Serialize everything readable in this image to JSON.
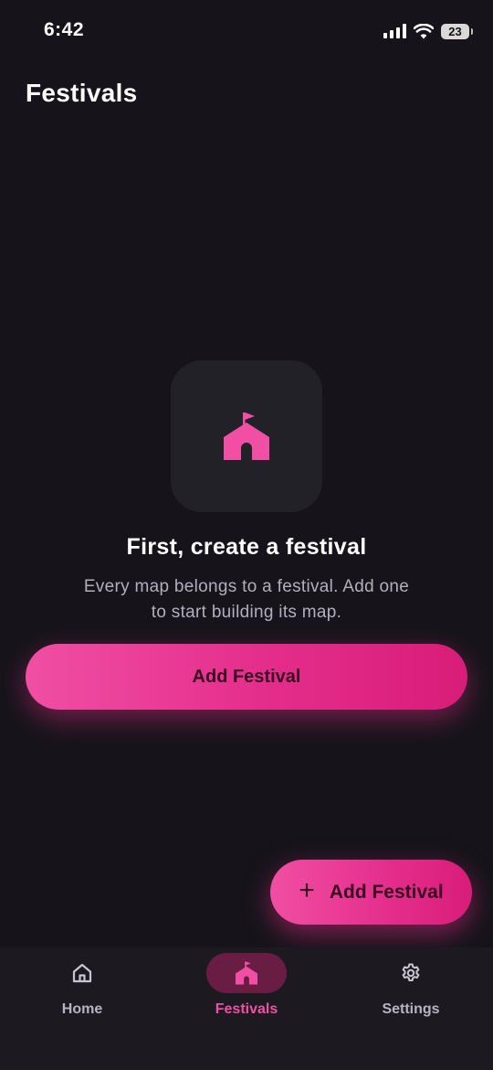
{
  "status_bar": {
    "time": "6:42",
    "battery_level": "23",
    "icons": [
      "cellular-signal-icon",
      "wifi-icon",
      "battery-icon"
    ]
  },
  "header": {
    "title": "Festivals"
  },
  "empty_state": {
    "icon": "festival-tent-icon",
    "title": "First, create a festival",
    "description": "Every map belongs to a festival. Add one to start building its map.",
    "button_label": "Add Festival"
  },
  "fab": {
    "icon": "plus-icon",
    "label": "Add Festival"
  },
  "bottom_nav": {
    "items": [
      {
        "label": "Home",
        "icon": "home-icon",
        "active": false
      },
      {
        "label": "Festivals",
        "icon": "festival-tent-icon",
        "active": true
      },
      {
        "label": "Settings",
        "icon": "gear-icon",
        "active": false
      }
    ]
  },
  "colors": {
    "background": "#16141a",
    "accent": "#e42d8b",
    "accent_light": "#f04fa3",
    "tile": "#232128",
    "nav_background": "#1c1a20",
    "nav_active_pill": "#6a1d43",
    "muted_text": "#b3afb8"
  }
}
